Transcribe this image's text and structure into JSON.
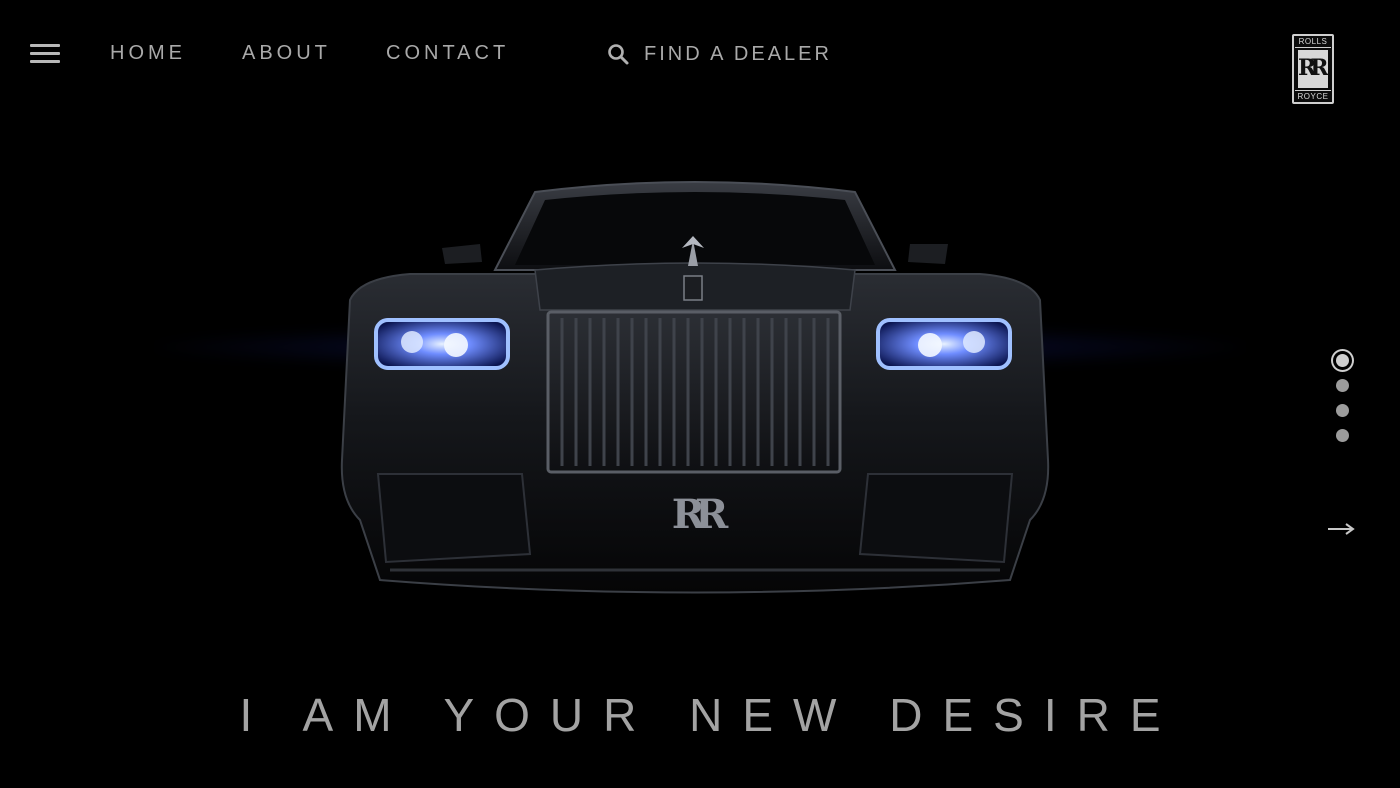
{
  "nav": {
    "menu_icon": "hamburger-menu-icon",
    "links": [
      "HOME",
      "ABOUT",
      "CONTACT"
    ],
    "search_icon": "search-icon",
    "search_label": "FIND A DEALER"
  },
  "logo": {
    "top_text": "ROLLS",
    "monogram": "RR",
    "bottom_text": "ROYCE"
  },
  "hero": {
    "image": "rolls-royce-phantom-front-view",
    "headline": "I AM YOUR NEW DESIRE"
  },
  "carousel": {
    "total_slides": 4,
    "active_slide": 1,
    "next_icon": "arrow-right-icon"
  },
  "colors": {
    "background": "#000000",
    "text": "#a9a9a9",
    "headlight_glow": "#3a5cff"
  }
}
